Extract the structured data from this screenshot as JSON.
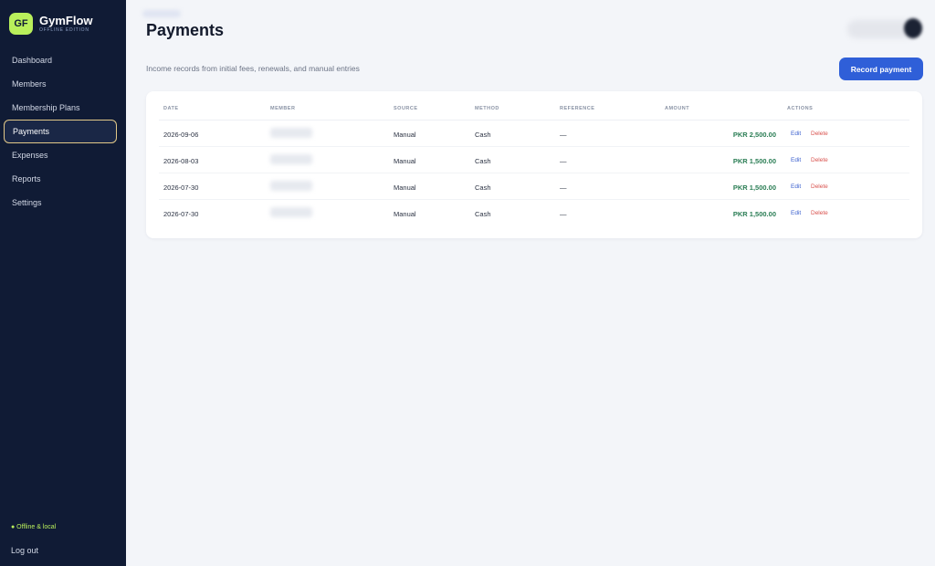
{
  "brand": {
    "logo": "GF",
    "name": "GymFlow",
    "edition": "OFFLINE EDITION"
  },
  "nav": [
    {
      "label": "Dashboard"
    },
    {
      "label": "Members"
    },
    {
      "label": "Membership Plans"
    },
    {
      "label": "Payments",
      "active": true
    },
    {
      "label": "Expenses"
    },
    {
      "label": "Reports"
    },
    {
      "label": "Settings"
    }
  ],
  "sidebar_footer": {
    "status": "● Offline & local",
    "logout": "Log out"
  },
  "header": {
    "title": "Payments",
    "subtitle": "Income records from initial fees, renewals, and manual entries",
    "record_button": "Record payment"
  },
  "table": {
    "columns": [
      "DATE",
      "MEMBER",
      "SOURCE",
      "METHOD",
      "REFERENCE",
      "AMOUNT",
      "ACTIONS"
    ],
    "rows": [
      {
        "date": "2026-09-06",
        "source": "Manual",
        "method": "Cash",
        "reference": "—",
        "amount": "PKR 2,500.00",
        "edit": "Edit",
        "delete": "Delete"
      },
      {
        "date": "2026-08-03",
        "source": "Manual",
        "method": "Cash",
        "reference": "—",
        "amount": "PKR 1,500.00",
        "edit": "Edit",
        "delete": "Delete"
      },
      {
        "date": "2026-07-30",
        "source": "Manual",
        "method": "Cash",
        "reference": "—",
        "amount": "PKR 1,500.00",
        "edit": "Edit",
        "delete": "Delete"
      },
      {
        "date": "2026-07-30",
        "source": "Manual",
        "method": "Cash",
        "reference": "—",
        "amount": "PKR 1,500.00",
        "edit": "Edit",
        "delete": "Delete"
      }
    ]
  },
  "colors": {
    "sidebar": "#101b35",
    "accent": "#2f5fd8",
    "logo": "#b9ef5b",
    "active_border": "#e2c888",
    "amount": "#2a7d54",
    "delete": "#d9534f"
  }
}
